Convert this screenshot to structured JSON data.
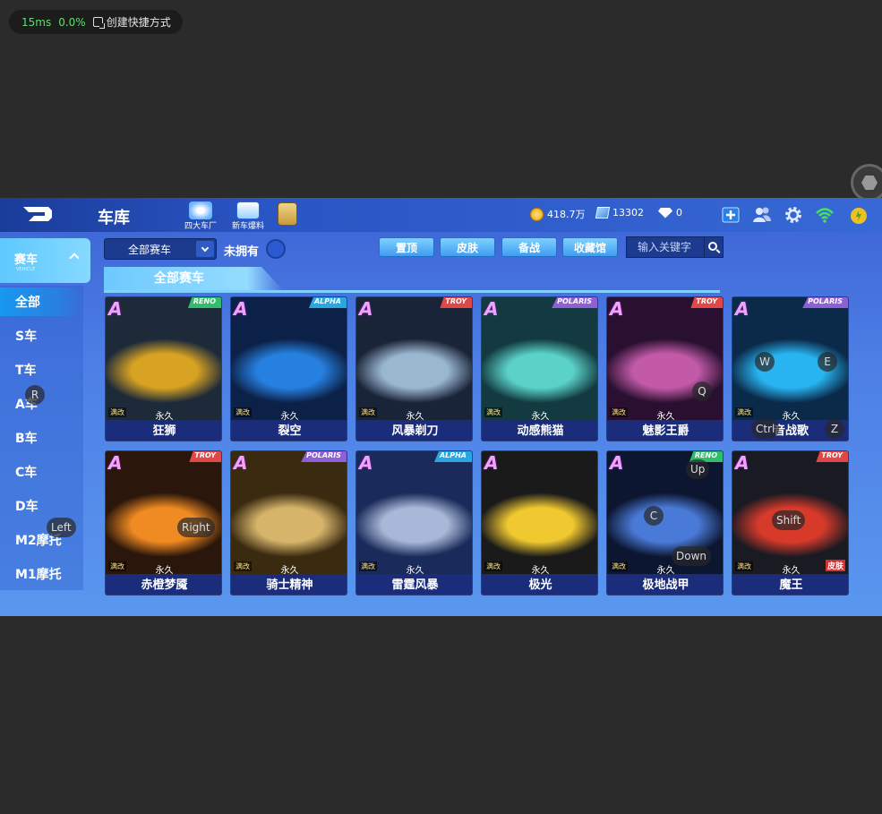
{
  "overlay": {
    "latency": "15ms",
    "loss": "0.0%",
    "shortcut_label": "创建快捷方式"
  },
  "header": {
    "title": "车库",
    "buttons": [
      {
        "label": "四大车厂"
      },
      {
        "label": "新车爆料"
      }
    ],
    "coins": "418.7万",
    "cards": "13302",
    "gems": "0"
  },
  "sidebar": {
    "head_title": "赛车",
    "head_sub": "VEHICLE",
    "items": [
      "全部",
      "S车",
      "T车",
      "A车",
      "B车",
      "C车",
      "D车",
      "M2摩托",
      "M1摩托"
    ]
  },
  "toolbar": {
    "filter_value": "全部赛车",
    "unowned_label": "未拥有",
    "actions": [
      "置顶",
      "皮肤",
      "备战",
      "收藏馆"
    ],
    "search_placeholder": "输入关键字"
  },
  "section_title": "全部赛车",
  "cars": [
    {
      "name": "狂狮",
      "grade": "A",
      "brand": "RENO",
      "mod": "满改",
      "perm": "永久",
      "brand_color": "#2fbf6a",
      "c1": "#d8a322",
      "c2": "#1d2a3a"
    },
    {
      "name": "裂空",
      "grade": "A",
      "brand": "ALPHA",
      "mod": "满改",
      "perm": "永久",
      "brand_color": "#2aa6e0",
      "c1": "#2680e0",
      "c2": "#0c2148"
    },
    {
      "name": "风暴剃刀",
      "grade": "A",
      "brand": "TROY",
      "mod": "满改",
      "perm": "永久",
      "brand_color": "#e04848",
      "c1": "#9ab7d0",
      "c2": "#1a2438"
    },
    {
      "name": "动感熊猫",
      "grade": "A",
      "brand": "POLARIS",
      "mod": "满改",
      "perm": "永久",
      "brand_color": "#8f5fd6",
      "c1": "#5ad2c8",
      "c2": "#123a40"
    },
    {
      "name": "魅影王爵",
      "grade": "A",
      "brand": "TROY",
      "mod": "满改",
      "perm": "永久",
      "brand_color": "#e04848",
      "c1": "#c25aa8",
      "c2": "#2a1030"
    },
    {
      "name": "音战歌",
      "grade": "A",
      "brand": "POLARIS",
      "mod": "满改",
      "perm": "永久",
      "brand_color": "#8f5fd6",
      "c1": "#28b4f0",
      "c2": "#0b2a4a"
    },
    {
      "name": "赤橙梦魇",
      "grade": "A",
      "brand": "TROY",
      "mod": "满改",
      "perm": "永久",
      "brand_color": "#e04848",
      "c1": "#f08a22",
      "c2": "#2a160a"
    },
    {
      "name": "骑士精神",
      "grade": "A",
      "brand": "POLARIS",
      "mod": "满改",
      "perm": "永久",
      "brand_color": "#8f5fd6",
      "c1": "#d6b46a",
      "c2": "#3a2a10"
    },
    {
      "name": "雷霆风暴",
      "grade": "A",
      "brand": "ALPHA",
      "mod": "满改",
      "perm": "永久",
      "brand_color": "#2aa6e0",
      "c1": "#a8b8d8",
      "c2": "#1a2a5a"
    },
    {
      "name": "极光",
      "grade": "A",
      "brand": "",
      "mod": "满改",
      "perm": "永久",
      "brand_color": "#8f5fd6",
      "c1": "#f0c830",
      "c2": "#1a1a1a"
    },
    {
      "name": "极地战甲",
      "grade": "A",
      "brand": "RENO",
      "mod": "满改",
      "perm": "永久",
      "brand_color": "#2fbf6a",
      "c1": "#4a7ad8",
      "c2": "#0c1630"
    },
    {
      "name": "魔王",
      "grade": "A",
      "brand": "TROY",
      "mod": "满改",
      "perm": "永久",
      "skin": "皮肤",
      "brand_color": "#e04848",
      "c1": "#d83a2a",
      "c2": "#1a1a22"
    }
  ],
  "key_hints": [
    "R",
    "Left",
    "Right",
    "W",
    "E",
    "Q",
    "Ctrl",
    "Z",
    "Up",
    "C",
    "Down",
    "Shift"
  ],
  "colors": {
    "coin": "#f0b020",
    "active_tab": "#1898f0",
    "card_name_bg": "#1b2d7a"
  }
}
